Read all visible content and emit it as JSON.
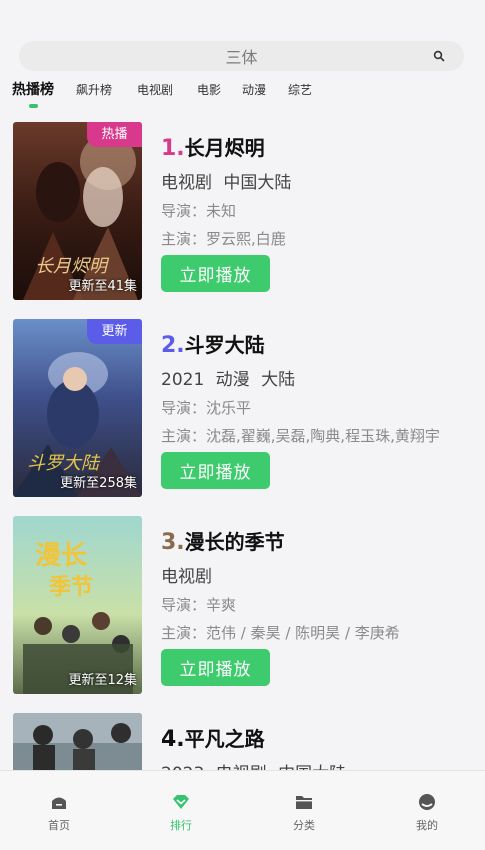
{
  "search": {
    "placeholder": "三体"
  },
  "tabs": [
    {
      "label": "热播榜",
      "active": true
    },
    {
      "label": "飙升榜"
    },
    {
      "label": "电视剧"
    },
    {
      "label": "电影"
    },
    {
      "label": "动漫"
    },
    {
      "label": "综艺"
    }
  ],
  "items": [
    {
      "rank": "1.",
      "title": "长月烬明",
      "meta": " 电视剧 中国大陆",
      "director": "导演：未知",
      "actors": "主演：罗云熙,白鹿",
      "badge": "热播",
      "update": "更新至41集",
      "play": "立即播放"
    },
    {
      "rank": "2.",
      "title": "斗罗大陆",
      "meta": "2021 动漫 大陆",
      "director": "导演：沈乐平",
      "actors": "主演：沈磊,翟巍,吴磊,陶典,程玉珠,黄翔宇",
      "badge": "更新",
      "update": "更新至258集",
      "play": "立即播放"
    },
    {
      "rank": "3.",
      "title": "漫长的季节",
      "meta": " 电视剧",
      "director": "导演：辛爽",
      "actors": "主演：范伟 / 秦昊 / 陈明昊 / 李庚希",
      "update": "更新至12集",
      "play": "立即播放"
    },
    {
      "rank": "4.",
      "title": "平凡之路",
      "meta": "2023 电视剧 中国大陆"
    }
  ],
  "nav": [
    {
      "label": "首页"
    },
    {
      "label": "排行",
      "active": true
    },
    {
      "label": "分类"
    },
    {
      "label": "我的"
    }
  ],
  "colors": {
    "accent": "#3ecb6d",
    "rank1": "#d63a8a",
    "rank2": "#5b5ce8",
    "rank3": "#8a6a4c",
    "badge_hot": "#d8398c",
    "badge_new": "#5b5ce8"
  }
}
